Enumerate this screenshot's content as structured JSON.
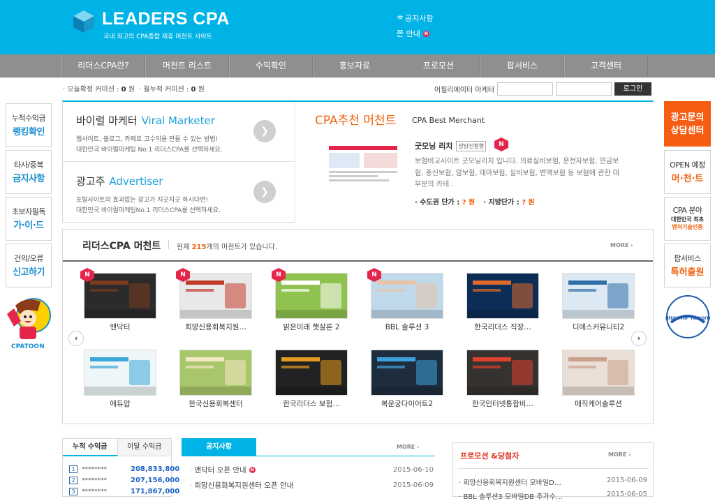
{
  "header": {
    "logo_text": "LEADERS CPA",
    "tagline": "국내 최고의 CPA종합 제휴 머천트 사이트",
    "notice_label": "공지사항",
    "notice_item": "쫀 안내",
    "new_badge": "N"
  },
  "nav": [
    "리더스CPA란?",
    "머천트 리스트",
    "수익확인",
    "홍보자료",
    "프로모션",
    "팝서비스",
    "고객센터"
  ],
  "commission": {
    "today_label": "· 오늘확정 커미션 :",
    "today_value": "0",
    "today_unit": "원",
    "month_label": "· 월누적 커미션 :",
    "month_value": "0",
    "month_unit": "원"
  },
  "affiliate": {
    "label": "어필리에이터 마케터",
    "id_value": "",
    "pw_value": "",
    "login_label": "로그인"
  },
  "left_menu": [
    {
      "top": "누적수익금",
      "main": "랭킹확인"
    },
    {
      "top": "타사/중복",
      "main": "금지사항"
    },
    {
      "top": "초보자필독",
      "main": "가·이·드"
    },
    {
      "top": "건의/오류",
      "main": "신고하기"
    }
  ],
  "cpatoon": "CPATOON",
  "right_menu": {
    "ad": [
      "광고문의",
      "상담센터"
    ],
    "open": {
      "top": "OPEN 예정",
      "main": "머·천·트"
    },
    "cpa": {
      "top": "CPA 분야",
      "sub1": "대한민국 최초",
      "sub2": "벤처기술인증"
    },
    "pop": {
      "top": "팝서비스",
      "main": "특허출원"
    },
    "venture_text": "Venture for Tomorrow"
  },
  "promo": {
    "viral": {
      "title_kr": "바이럴 마케터",
      "title_en": "Viral Marketer",
      "desc1": "웹사이트, 블로그, 카페로 고수익을 만들 수 있는 방법!",
      "desc2": "대한민국 바이럴마케팅 No.1 리더스CPA를 선택하세요."
    },
    "advertiser": {
      "title_kr": "광고주",
      "title_en": "Advertiser",
      "desc1": "포털사이트의 효과없는 광고가 지긋지긋 하시다면!",
      "desc2": "대한민국 바이럴마케팅No.1 리더스CPA를 선택하세요."
    },
    "arrow": "❯",
    "recommend": {
      "title": "CPA추천 머천트",
      "subtitle": "CPA Best Merchant",
      "name": "굿모닝 리치",
      "badge": "상담신청형",
      "n_badge": "N",
      "desc": "보험비교사이트 굿모닝리치 입니다. 의료실비보험, 운전자보험, 연금보험, 종신보험, 암보험, 태아보험, 실비보험, 변액보험 등 보험에 관한 대부분의 카테..",
      "price1_label": "· 수도권 단가 :",
      "price1_value": "? 원",
      "price2_label": "· 지방단가 :",
      "price2_value": "? 원"
    }
  },
  "merchants": {
    "title": "리더스CPA 머천트",
    "count_prefix": "현재",
    "count": "215",
    "count_suffix": "개의 머천트가 있습니다.",
    "more": "MORE",
    "new_badge": "N",
    "items": [
      {
        "name": "맨닥터",
        "new": true,
        "color": "#2b2b2b",
        "accent": "#7a3a1c"
      },
      {
        "name": "희망신용회복지원…",
        "new": true,
        "color": "#e8e8e8",
        "accent": "#c23a2c"
      },
      {
        "name": "밝은미래 햇살론 2",
        "new": true,
        "color": "#8fc24e",
        "accent": "#ffffff"
      },
      {
        "name": "BBL 솔루션 3",
        "new": true,
        "color": "#bfd8ea",
        "accent": "#e9c3a8"
      },
      {
        "name": "한국리더스 직장…",
        "new": false,
        "color": "#0c2d55",
        "accent": "#e06a2a"
      },
      {
        "name": "디에스커뮤니티2",
        "new": false,
        "color": "#dce9f3",
        "accent": "#2f6ea6"
      },
      {
        "name": "에듀얍",
        "new": false,
        "color": "#eef6f8",
        "accent": "#3aa7d6"
      },
      {
        "name": "한국신용회복센터",
        "new": false,
        "color": "#a8c66a",
        "accent": "#f5e7c6"
      },
      {
        "name": "한국리더스 보험…",
        "new": false,
        "color": "#222222",
        "accent": "#e39a1f"
      },
      {
        "name": "복운궁다이어트2",
        "new": false,
        "color": "#1e2d3d",
        "accent": "#3ea0d8"
      },
      {
        "name": "한국인터넷통합비…",
        "new": false,
        "color": "#36322f",
        "accent": "#e0402d"
      },
      {
        "name": "매직케어솔루션",
        "new": false,
        "color": "#eadfd6",
        "accent": "#c9a18e"
      }
    ]
  },
  "ranking": {
    "tab1": "누적 수익금",
    "tab2": "이달 수익금",
    "rows": [
      {
        "rank": "1",
        "user": "********",
        "value": "208,833,800"
      },
      {
        "rank": "2",
        "user": "********",
        "value": "207,156,000"
      },
      {
        "rank": "3",
        "user": "********",
        "value": "171,867,000"
      }
    ]
  },
  "notice": {
    "tab": "공지사항",
    "more": "MORE",
    "rows": [
      {
        "title": "맨닥터 오픈 안내",
        "new": true,
        "date": "2015-06-10"
      },
      {
        "title": "희망신용회복지원센터 오픈 안내",
        "new": false,
        "date": "2015-06-09"
      }
    ]
  },
  "promotion": {
    "title": "프로모션 &당첨자",
    "more": "MORE",
    "rows": [
      {
        "title": "· 희망신용회복지원센터 모바일D…",
        "date": "2015-06-09"
      },
      {
        "title": "· BBL 솔루션3 모바일DB 추가수…",
        "date": "2015-06-05"
      }
    ]
  }
}
